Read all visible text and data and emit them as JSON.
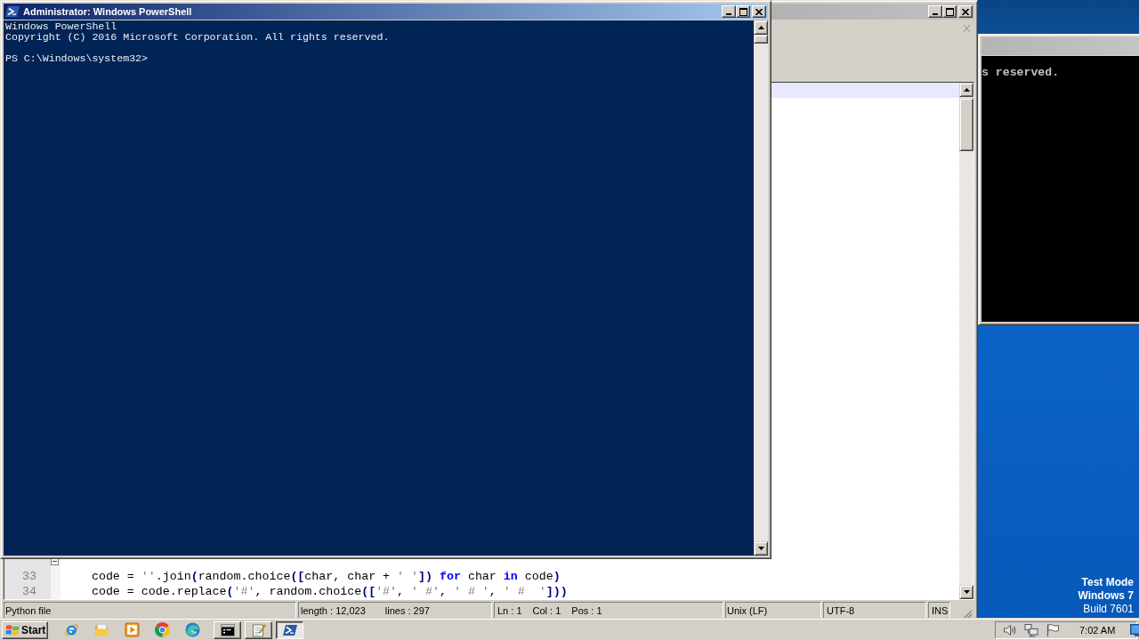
{
  "powershell_window": {
    "active": true,
    "title": "Administrator: Windows PowerShell",
    "console_lines": [
      "Windows PowerShell",
      "Copyright (C) 2016 Microsoft Corporation. All rights reserved."
    ],
    "prompt": "PS C:\\Windows\\system32>"
  },
  "notepad_window": {
    "active": false,
    "editor": {
      "lines": [
        {
          "foldable": true
        },
        {
          "number": "33",
          "foldable": false,
          "tokens": [
            {
              "kind": "plain",
              "text": "    code = "
            },
            {
              "kind": "string",
              "text": "''"
            },
            {
              "kind": "plain",
              "text": ".join"
            },
            {
              "kind": "operator",
              "text": "("
            },
            {
              "kind": "plain",
              "text": "random.choice"
            },
            {
              "kind": "operator",
              "text": "(["
            },
            {
              "kind": "plain",
              "text": "char, char + "
            },
            {
              "kind": "string",
              "text": "' '"
            },
            {
              "kind": "operator",
              "text": "])"
            },
            {
              "kind": "keyword",
              "text": " for"
            },
            {
              "kind": "plain",
              "text": " char "
            },
            {
              "kind": "keyword",
              "text": "in"
            },
            {
              "kind": "plain",
              "text": " code"
            },
            {
              "kind": "operator",
              "text": ")"
            }
          ]
        },
        {
          "number": "34",
          "foldable": false,
          "tokens": [
            {
              "kind": "plain",
              "text": "    code = code.replace"
            },
            {
              "kind": "operator",
              "text": "("
            },
            {
              "kind": "string",
              "text": "'#'"
            },
            {
              "kind": "plain",
              "text": ", random.choice"
            },
            {
              "kind": "operator",
              "text": "(["
            },
            {
              "kind": "string",
              "text": "'#'"
            },
            {
              "kind": "plain",
              "text": ", "
            },
            {
              "kind": "string",
              "text": "' #'"
            },
            {
              "kind": "plain",
              "text": ", "
            },
            {
              "kind": "string",
              "text": "' # '"
            },
            {
              "kind": "plain",
              "text": ", "
            },
            {
              "kind": "string",
              "text": "' #  '"
            },
            {
              "kind": "operator",
              "text": "]))"
            }
          ]
        }
      ]
    },
    "status_bar": {
      "file_type": "Python file",
      "length": "length : 12,023",
      "lines": "lines : 297",
      "line": "Ln : 1",
      "column": "Col : 1",
      "position": "Pos : 1",
      "line_ending": "Unix (LF)",
      "encoding": "UTF-8",
      "mode": "INS"
    }
  },
  "cmd_window": {
    "active": false,
    "visible_text": "s reserved."
  },
  "desktop_notice": {
    "mode": "Test Mode",
    "os": "Windows 7",
    "build": "Build 7601"
  },
  "taskbar": {
    "start": "Start",
    "window_buttons": [
      {
        "kind": "console",
        "selected": false
      },
      {
        "kind": "notepad",
        "selected": false
      },
      {
        "kind": "powershell",
        "selected": true
      }
    ],
    "clock": "7:02 AM"
  }
}
